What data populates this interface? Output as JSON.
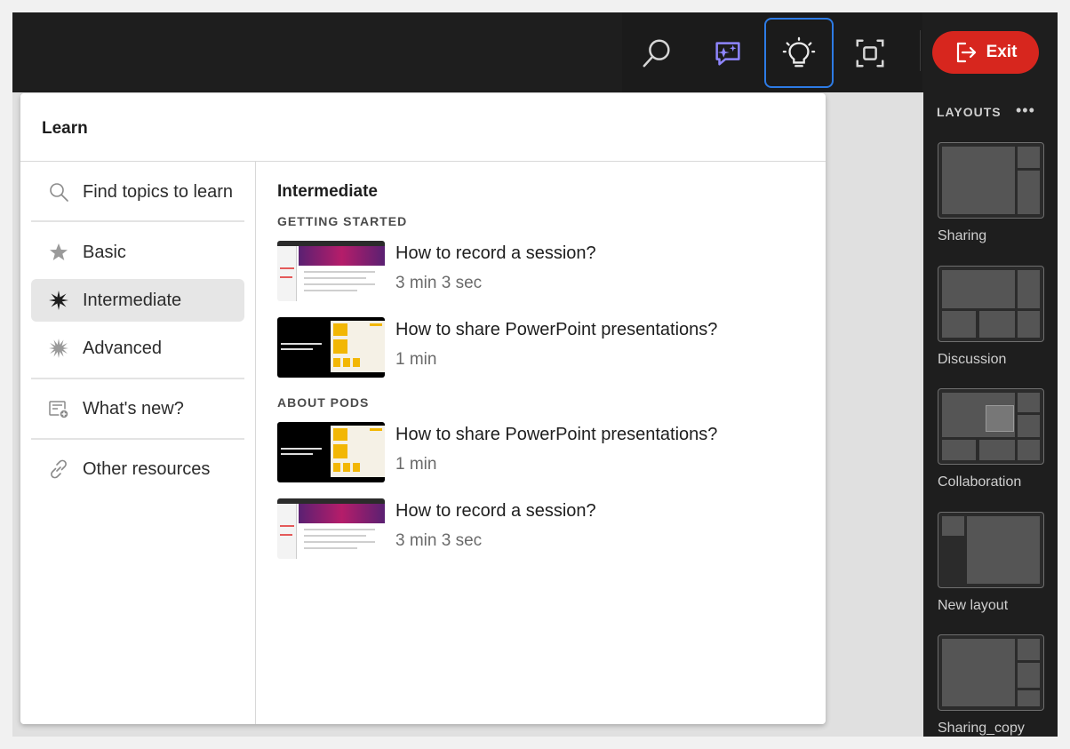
{
  "toolbar": {
    "search_icon": "search-icon",
    "assistant_icon": "ai-chat-icon",
    "learn_icon": "lightbulb-icon",
    "focus_icon": "focus-frame-icon",
    "exit_label": "Exit",
    "exit_color": "#d7261e",
    "active_outline_color": "#2d7be5"
  },
  "learn_panel": {
    "title": "Learn",
    "search_placeholder": "Find topics to learn",
    "nav": {
      "basic": "Basic",
      "intermediate": "Intermediate",
      "advanced": "Advanced",
      "whats_new": "What's new?",
      "other_resources": "Other resources"
    },
    "selected_level": "Intermediate",
    "section_title": "Intermediate",
    "categories": [
      {
        "name": "GETTING STARTED",
        "videos": [
          {
            "title": "How to record a session?",
            "duration": "3 min 3 sec"
          },
          {
            "title": "How to share PowerPoint presentations?",
            "duration": "1 min"
          }
        ]
      },
      {
        "name": "ABOUT PODS",
        "videos": [
          {
            "title": "How to share PowerPoint presentations?",
            "duration": "1 min"
          },
          {
            "title": "How to record a session?",
            "duration": "3 min 3 sec"
          }
        ]
      }
    ]
  },
  "layouts_panel": {
    "header": "LAYOUTS",
    "more_label": "•••",
    "items": [
      {
        "label": "Sharing"
      },
      {
        "label": "Discussion"
      },
      {
        "label": "Collaboration"
      },
      {
        "label": "New layout"
      },
      {
        "label": "Sharing_copy"
      }
    ]
  }
}
